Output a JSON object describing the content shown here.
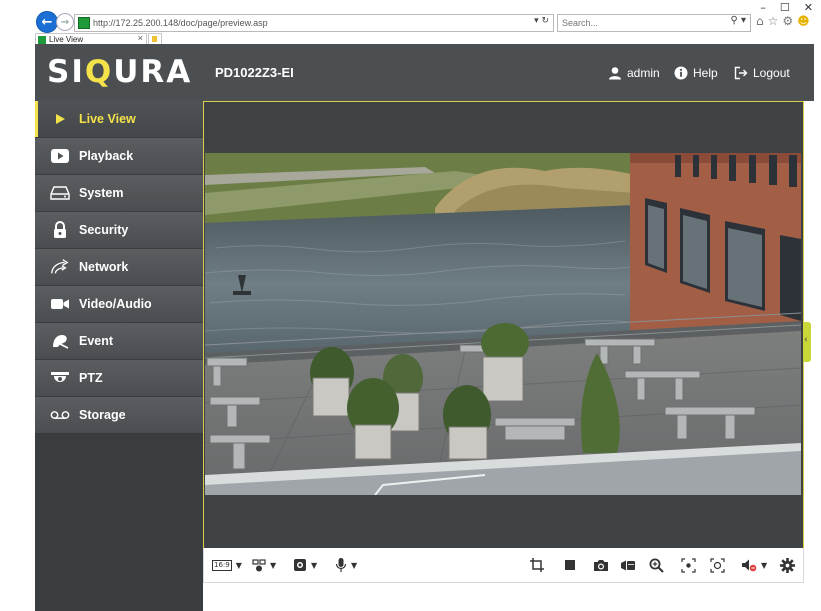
{
  "browser": {
    "url": "http://172.25.200.148/doc/page/preview.asp",
    "search_placeholder": "Search...",
    "tab_title": "Live View",
    "window_controls": [
      "–",
      "☐",
      "✕"
    ]
  },
  "header": {
    "logo_left": "SI",
    "logo_q": "Q",
    "logo_right": "URA",
    "model": "PD1022Z3-EI",
    "user_label": "admin",
    "help_label": "Help",
    "logout_label": "Logout",
    "accent_color": "#f3e24a"
  },
  "sidebar": {
    "items": [
      {
        "label": "Live View",
        "icon": "play-icon",
        "active": true
      },
      {
        "label": "Playback",
        "icon": "playback-icon"
      },
      {
        "label": "System",
        "icon": "system-icon"
      },
      {
        "label": "Security",
        "icon": "lock-icon"
      },
      {
        "label": "Network",
        "icon": "network-icon"
      },
      {
        "label": "Video/Audio",
        "icon": "camera-icon"
      },
      {
        "label": "Event",
        "icon": "event-icon"
      },
      {
        "label": "PTZ",
        "icon": "ptz-icon"
      },
      {
        "label": "Storage",
        "icon": "storage-icon"
      }
    ]
  },
  "controls": {
    "aspect_ratio": "16:9",
    "left": [
      "aspect-ratio-icon",
      "stream-select-icon",
      "plugin-select-icon",
      "microphone-icon"
    ],
    "right": [
      "crop-icon",
      "stop-icon",
      "snapshot-icon",
      "record-icon",
      "digital-zoom-icon",
      "focus-icon",
      "3d-position-icon",
      "audio-mute-icon",
      "settings-icon"
    ]
  }
}
